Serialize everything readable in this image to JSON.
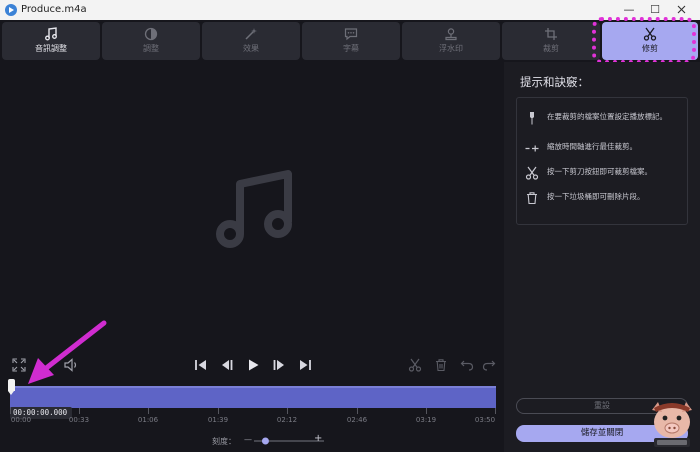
{
  "window": {
    "title": "Produce.m4a",
    "minimize_glyph": "—",
    "maximize_glyph": "☐"
  },
  "tabs": [
    {
      "label": "音訊調整",
      "icon": "music-note-icon"
    },
    {
      "label": "調整",
      "icon": "contrast-icon"
    },
    {
      "label": "效果",
      "icon": "magic-wand-icon"
    },
    {
      "label": "字幕",
      "icon": "subtitle-bubble-icon"
    },
    {
      "label": "浮水印",
      "icon": "watermark-icon"
    },
    {
      "label": "裁剪",
      "icon": "crop-icon"
    },
    {
      "label": "修剪",
      "icon": "scissors-icon"
    }
  ],
  "preview": {
    "icon": "music-note-icon"
  },
  "player": {
    "timecode": "00:00:00.000",
    "ticks": [
      "00:00",
      "00:33",
      "01:06",
      "01:39",
      "02:12",
      "02:46",
      "03:19",
      "03:50"
    ]
  },
  "zoom": {
    "label": "刻度：",
    "minus": "—",
    "plus": "+",
    "level": 0.12
  },
  "sidebar": {
    "title": "提示和訣竅：",
    "tips": [
      {
        "icon": "marker-pin-icon",
        "text": "在要裁剪的檔案位置設定播放標記。"
      },
      {
        "icon": "zoom-timeline-icon",
        "text": "縮放時間軸進行最佳裁剪。"
      },
      {
        "icon": "scissors-icon",
        "text": "按一下剪刀按鈕即可裁剪檔案。"
      },
      {
        "icon": "trash-icon",
        "text": "按一下垃圾桶即可刪除片段。"
      }
    ],
    "reset_label": "重設",
    "save_label": "儲存並關閉"
  },
  "colors": {
    "accent": "#a6a8f0",
    "timeline": "#5e64c6",
    "annotation": "#e032d8"
  }
}
